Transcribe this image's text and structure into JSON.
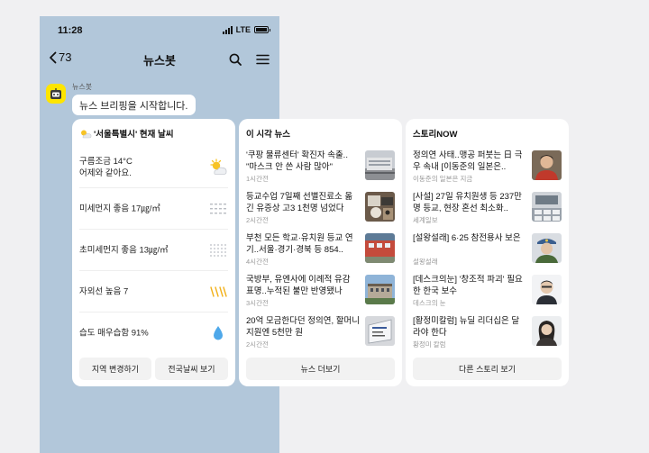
{
  "statusbar": {
    "time": "11:28",
    "network": "LTE"
  },
  "nav": {
    "back_count": "73",
    "title": "뉴스봇"
  },
  "chat": {
    "sender": "뉴스봇",
    "message": "뉴스 브리핑을 시작합니다."
  },
  "weather": {
    "title": "'서울특별시' 현재 날씨",
    "rows": [
      {
        "line1": "구름조금 14°C",
        "line2": "어제와 같아요.",
        "icon": "partly-cloudy-icon"
      },
      {
        "line1": "미세먼지 좋음 17㎍/㎥",
        "line2": "",
        "icon": "fine-dust-icon"
      },
      {
        "line1": "초미세먼지 좋음 13㎍/㎥",
        "line2": "",
        "icon": "ultrafine-dust-icon"
      },
      {
        "line1": "자외선 높음 7",
        "line2": "",
        "icon": "uv-icon"
      },
      {
        "line1": "습도 매우습함 91%",
        "line2": "",
        "icon": "humidity-drop-icon"
      }
    ],
    "buttons": [
      "지역 변경하기",
      "전국날씨 보기"
    ]
  },
  "news": {
    "title": "이 시각 뉴스",
    "items": [
      {
        "headline": "'쿠팡 물류센터' 확진자 속출.. \"마스크 안 쓴 사람 많아\"",
        "meta": "1시간전",
        "thumb": "warehouse-thumb"
      },
      {
        "headline": "등교수업 7일째 선별진료소 옮긴 유증상 고3 1천명 넘었다",
        "meta": "2시간전",
        "thumb": "clinic-thumb"
      },
      {
        "headline": "부천 모든 학교·유치원 등교 연기..서울·경기·경북 등 854..",
        "meta": "4시간전",
        "thumb": "school-thumb"
      },
      {
        "headline": "국방부, 유엔사에 이례적 유감 표명..누적된 불만 반영됐나",
        "meta": "3시간전",
        "thumb": "building-thumb"
      },
      {
        "headline": "20억 모금한다던 정의연, 할머니 지원엔 5천만 원",
        "meta": "2시간전",
        "thumb": "sign-thumb"
      }
    ],
    "button": "뉴스 더보기"
  },
  "story": {
    "title": "스토리NOW",
    "items": [
      {
        "headline": "정의연 사태..맹공 퍼붓는 日 극우 속내 [이동준의 일본은..",
        "meta": "이동준의 일본은 지금",
        "thumb": "portrait-thumb"
      },
      {
        "headline": "[사설] 27일 유치원생 등 237만명 등교, 현장 혼선 최소화..",
        "meta": "세계일보",
        "thumb": "classroom-thumb"
      },
      {
        "headline": "[설왕설래] 6·25 참전용사 보은",
        "meta": "설왕설래",
        "thumb": "veteran-thumb"
      },
      {
        "headline": "[데스크의눈] '창조적 파괴' 필요한 한국 보수",
        "meta": "데스크의 눈",
        "thumb": "columnist-thumb"
      },
      {
        "headline": "[황정미칼럼] 뉴딜 리더십은 달라야 한다",
        "meta": "황정미 칼럼",
        "thumb": "woman-portrait-thumb"
      }
    ],
    "button": "다른 스토리 보기"
  }
}
